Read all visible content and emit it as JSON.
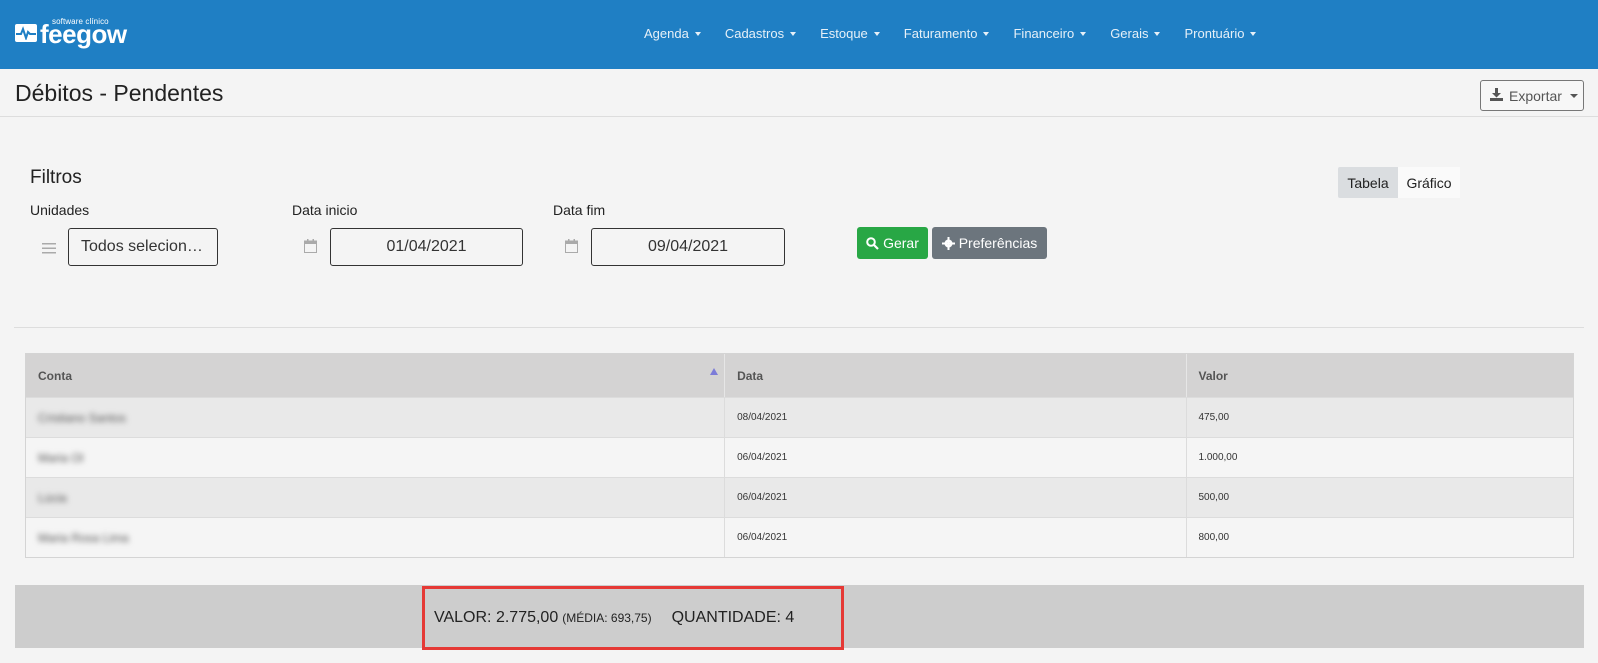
{
  "app": {
    "logo_small": "software clínico",
    "logo_word": "feegow"
  },
  "nav": {
    "items": [
      "Agenda",
      "Cadastros",
      "Estoque",
      "Faturamento",
      "Financeiro",
      "Gerais",
      "Prontuário"
    ]
  },
  "header": {
    "title": "Débitos - Pendentes",
    "export_label": "Exportar"
  },
  "filters": {
    "title": "Filtros",
    "unidades_label": "Unidades",
    "unidades_value": "Todos selecion…",
    "data_inicio_label": "Data inicio",
    "data_inicio_value": "01/04/2021",
    "data_fim_label": "Data fim",
    "data_fim_value": "09/04/2021",
    "gerar_label": "Gerar",
    "preferencias_label": "Preferências"
  },
  "view_toggle": {
    "tabela": "Tabela",
    "grafico": "Gráfico",
    "selected": "Tabela"
  },
  "table": {
    "columns": [
      "Conta",
      "Data",
      "Valor"
    ],
    "rows": [
      {
        "conta": "Cristiano Santos",
        "data": "08/04/2021",
        "valor": "475,00"
      },
      {
        "conta": "Maria Ol",
        "data": "06/04/2021",
        "valor": "1.000,00"
      },
      {
        "conta": "Lúcia",
        "data": "06/04/2021",
        "valor": "500,00"
      },
      {
        "conta": "Maria Rosa Lima",
        "data": "06/04/2021",
        "valor": "800,00"
      }
    ]
  },
  "summary": {
    "valor_text": "VALOR: 2.775,00",
    "media_text": "(MÉDIA: 693,75)",
    "quantidade_text": "QUANTIDADE: 4"
  },
  "colors": {
    "topbar": "#1f7fc4",
    "gerar": "#28a745",
    "preferencias": "#6c757d",
    "highlight": "#e53935"
  }
}
